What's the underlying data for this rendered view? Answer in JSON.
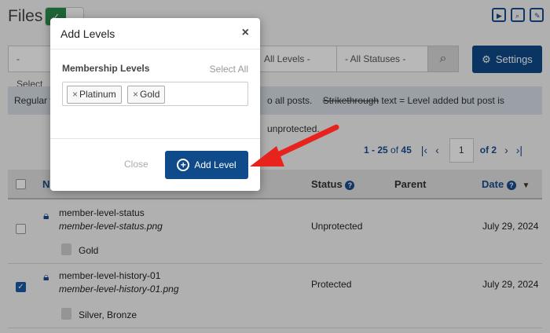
{
  "page": {
    "title": "Files",
    "filters": {
      "first": "- Select",
      "levels": "All Levels -",
      "statuses": "- All Statuses -"
    },
    "settings_label": "Settings",
    "notice": {
      "left": "Regular t",
      "right_prefix": "o all posts.",
      "strike_word": "Strikethrough",
      "right_suffix": " text = Level added but post is unprotected."
    },
    "pagination": {
      "range": "1 - 25",
      "of_label": "of",
      "total": "45",
      "current_page": "1",
      "pages_label": "of 2"
    },
    "table": {
      "headers": {
        "name": "N",
        "status": "Status",
        "parent": "Parent",
        "date": "Date"
      },
      "rows": [
        {
          "name": "member-level-status",
          "file": "member-level-status.png",
          "levels": "Gold",
          "status": "Unprotected",
          "date": "July 29, 2024",
          "checked": false
        },
        {
          "name": "member-level-history-01",
          "file": "member-level-history-01.png",
          "levels": "Silver, Bronze",
          "status": "Protected",
          "date": "July 29, 2024",
          "checked": true
        }
      ]
    }
  },
  "modal": {
    "title": "Add Levels",
    "section_label": "Membership Levels",
    "select_all": "Select All",
    "tags": [
      "Platinum",
      "Gold"
    ],
    "close_label": "Close",
    "add_label": "Add Level"
  },
  "colors": {
    "primary": "#0f4a8a",
    "toggle_on": "#2a8d4a",
    "arrow": "#e8231d"
  }
}
